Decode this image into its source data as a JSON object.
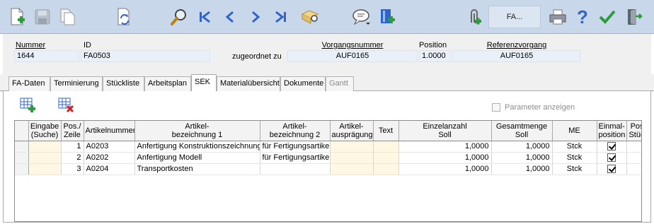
{
  "toolbar": {
    "buttons": [
      {
        "icon": "new-document-icon"
      },
      {
        "icon": "save-disk-icon"
      },
      {
        "icon": "copy-documents-icon"
      },
      {
        "icon": "refresh-document-icon"
      },
      {
        "icon": "search-magnifier-icon"
      },
      {
        "icon": "first-record-icon"
      },
      {
        "icon": "previous-record-icon"
      },
      {
        "icon": "next-record-icon"
      },
      {
        "icon": "last-record-icon"
      },
      {
        "icon": "find-record-icon"
      },
      {
        "icon": "speech-bubble-icon"
      },
      {
        "icon": "add-book-icon"
      },
      {
        "icon": "attachment-icon"
      },
      {
        "icon": "printer-icon"
      },
      {
        "icon": "help-icon"
      },
      {
        "icon": "confirm-check-icon"
      },
      {
        "icon": "exit-door-icon"
      }
    ],
    "fa_label": "FA..."
  },
  "header": {
    "nummer_label": "Nummer",
    "nummer_value": "1644",
    "id_label": "ID",
    "id_value": "FA0503",
    "zugeordnet_label": "zugeordnet zu",
    "vorgang_label": "Vorgangsnummer",
    "vorgang_value": "AUF0165",
    "position_label": "Position",
    "position_value": "1.0000",
    "referenz_label": "Referenzvorgang",
    "referenz_value": "AUF0165"
  },
  "tabs": [
    {
      "label": "FA-Daten",
      "state": "normal"
    },
    {
      "label": "Terminierung",
      "state": "normal"
    },
    {
      "label": "Stückliste",
      "state": "normal"
    },
    {
      "label": "Arbeitsplan",
      "state": "normal"
    },
    {
      "label": "SEK",
      "state": "active"
    },
    {
      "label": "Materialübersicht",
      "state": "normal"
    },
    {
      "label": "Dokumente",
      "state": "normal"
    },
    {
      "label": "Gantt",
      "state": "disabled"
    }
  ],
  "sek": {
    "param_label": "Parameter anzeigen",
    "columns": [
      {
        "line1": "",
        "line2": ""
      },
      {
        "line1": "Eingabe",
        "line2": "(Suche)"
      },
      {
        "line1": "Pos./",
        "line2": "Zeile"
      },
      {
        "line1": "Artikelnummer",
        "line2": ""
      },
      {
        "line1": "Artikel-",
        "line2": "bezeichnung 1"
      },
      {
        "line1": "Artikel-",
        "line2": "bezeichnung 2"
      },
      {
        "line1": "Artikel-",
        "line2": "ausprägung"
      },
      {
        "line1": "Text",
        "line2": ""
      },
      {
        "line1": "Einzelanzahl",
        "line2": "Soll"
      },
      {
        "line1": "Gesamtmenge",
        "line2": "Soll"
      },
      {
        "line1": "ME",
        "line2": ""
      },
      {
        "line1": "Einmal-",
        "line2": "position"
      },
      {
        "line1": "Pos. aus",
        "line2": "Stückliste"
      }
    ],
    "rows": [
      {
        "pos": "1",
        "artnr": "A0203",
        "bez1": "Anfertigung Konstruktionszeichnung",
        "bez2": "für Fertigungsartikel",
        "auspr": "",
        "text": "",
        "einzel": "1,0000",
        "gesamt": "1,0000",
        "me": "Stck",
        "einmal": true,
        "stueckliste": true
      },
      {
        "pos": "2",
        "artnr": "A0202",
        "bez1": "Anfertigung Modell",
        "bez2": "für Fertigungsartikel",
        "auspr": "",
        "text": "",
        "einzel": "1,0000",
        "gesamt": "1,0000",
        "me": "Stck",
        "einmal": true,
        "stueckliste": true
      },
      {
        "pos": "3",
        "artnr": "A0204",
        "bez1": "Transportkosten",
        "bez2": "",
        "auspr": "",
        "text": "",
        "einzel": "1,0000",
        "gesamt": "1,0000",
        "me": "Stck",
        "einmal": true,
        "stueckliste": false
      }
    ]
  },
  "colors": {
    "toolbar_bg": "#c8d7ea",
    "field_bg": "#e9f0f8",
    "nav_blue": "#2f64c8",
    "confirm_green": "#2e9a3c"
  }
}
